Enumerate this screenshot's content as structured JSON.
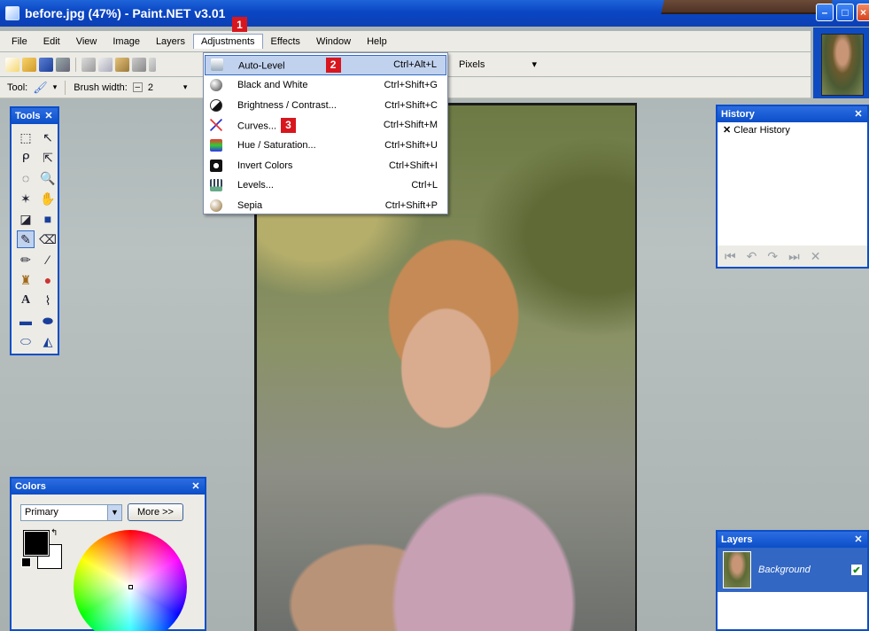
{
  "window": {
    "title": "before.jpg (47%) - Paint.NET v3.01"
  },
  "menubar": {
    "items": [
      "File",
      "Edit",
      "View",
      "Image",
      "Layers",
      "Adjustments",
      "Effects",
      "Window",
      "Help"
    ]
  },
  "callouts": {
    "one": "1",
    "two": "2",
    "three": "3"
  },
  "toolbar": {
    "tool_label": "Tool:",
    "brush_width_label": "Brush width:",
    "brush_width_value": "2",
    "units_value": "Pixels"
  },
  "adjustments_menu": {
    "items": [
      {
        "label": "Auto-Level",
        "shortcut": "Ctrl+Alt+L"
      },
      {
        "label": "Black and White",
        "shortcut": "Ctrl+Shift+G"
      },
      {
        "label": "Brightness / Contrast...",
        "shortcut": "Ctrl+Shift+C"
      },
      {
        "label": "Curves...",
        "shortcut": "Ctrl+Shift+M"
      },
      {
        "label": "Hue / Saturation...",
        "shortcut": "Ctrl+Shift+U"
      },
      {
        "label": "Invert Colors",
        "shortcut": "Ctrl+Shift+I"
      },
      {
        "label": "Levels...",
        "shortcut": "Ctrl+L"
      },
      {
        "label": "Sepia",
        "shortcut": "Ctrl+Shift+P"
      }
    ]
  },
  "tools_panel": {
    "title": "Tools"
  },
  "history_panel": {
    "title": "History",
    "items": [
      "Clear History"
    ]
  },
  "layers_panel": {
    "title": "Layers",
    "layer_name": "Background"
  },
  "colors_panel": {
    "title": "Colors",
    "mode": "Primary",
    "more_button": "More >>"
  },
  "colors": {
    "accent": "#0b4ec7",
    "highlight": "#c1d2ee",
    "callout": "#d8161e"
  }
}
